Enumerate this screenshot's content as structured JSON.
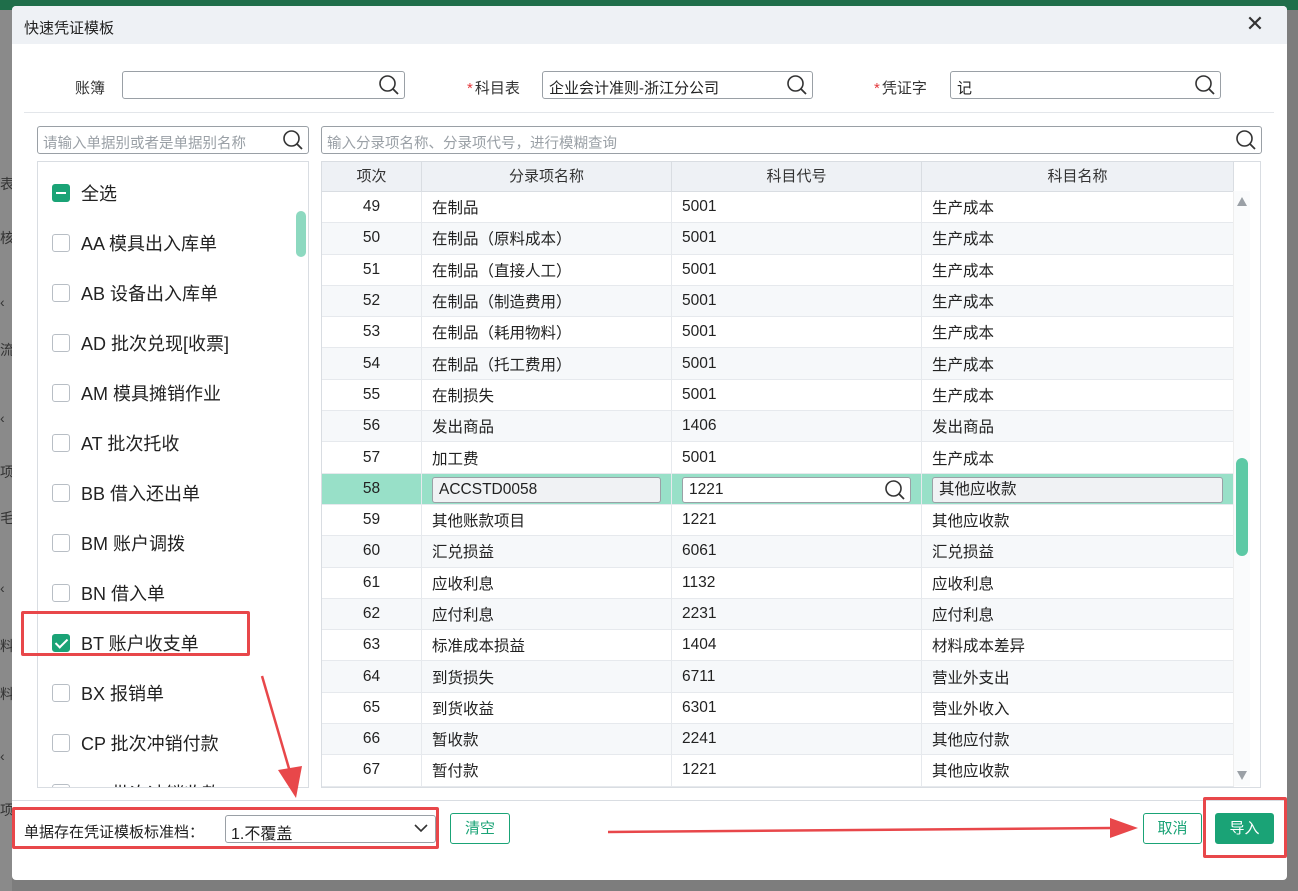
{
  "background": {
    "left_chars": [
      "表",
      "核",
      "‹",
      "流",
      "‹",
      "项",
      "毛",
      "‹",
      "料",
      "料",
      "‹",
      "项"
    ]
  },
  "dialog": {
    "title": "快速凭证模板",
    "close_glyph": "✕"
  },
  "filters": {
    "account_book": {
      "label": "账簿",
      "value": ""
    },
    "subject_table": {
      "label": "科目表",
      "required_mark": "*",
      "value": "企业会计准则-浙江分公司"
    },
    "voucher_type": {
      "label": "凭证字",
      "required_mark": "*",
      "value": "记"
    },
    "bill_search_placeholder": "请输入单据别或者是单据别名称",
    "entry_search_placeholder": "输入分录项名称、分录项代号，进行模糊查询"
  },
  "bill_list": {
    "items": [
      {
        "label": "全选",
        "state": "partial"
      },
      {
        "label": "AA 模具出入库单",
        "state": "unchecked"
      },
      {
        "label": "AB 设备出入库单",
        "state": "unchecked"
      },
      {
        "label": "AD 批次兑现[收票]",
        "state": "unchecked"
      },
      {
        "label": "AM 模具摊销作业",
        "state": "unchecked"
      },
      {
        "label": "AT 批次托收",
        "state": "unchecked"
      },
      {
        "label": "BB 借入还出单",
        "state": "unchecked"
      },
      {
        "label": "BM 账户调拨",
        "state": "unchecked"
      },
      {
        "label": "BN 借入单",
        "state": "unchecked"
      },
      {
        "label": "BT 账户收支单",
        "state": "checked"
      },
      {
        "label": "BX 报销单",
        "state": "unchecked"
      },
      {
        "label": "CP 批次冲销付款",
        "state": "unchecked"
      },
      {
        "label": "CR 批次冲销收款",
        "state": "unchecked"
      }
    ]
  },
  "entry_table": {
    "columns": [
      "项次",
      "分录项名称",
      "科目代号",
      "科目名称"
    ],
    "rows": [
      [
        "49",
        "在制品",
        "5001",
        "生产成本"
      ],
      [
        "50",
        "在制品（原料成本）",
        "5001",
        "生产成本"
      ],
      [
        "51",
        "在制品（直接人工）",
        "5001",
        "生产成本"
      ],
      [
        "52",
        "在制品（制造费用）",
        "5001",
        "生产成本"
      ],
      [
        "53",
        "在制品（耗用物料）",
        "5001",
        "生产成本"
      ],
      [
        "54",
        "在制品（托工费用）",
        "5001",
        "生产成本"
      ],
      [
        "55",
        "在制损失",
        "5001",
        "生产成本"
      ],
      [
        "56",
        "发出商品",
        "1406",
        "发出商品"
      ],
      [
        "57",
        "加工费",
        "5001",
        "生产成本"
      ],
      [
        "58",
        "ACCSTD0058",
        "1221",
        "其他应收款"
      ],
      [
        "59",
        "其他账款项目",
        "1221",
        "其他应收款"
      ],
      [
        "60",
        "汇兑损益",
        "6061",
        "汇兑损益"
      ],
      [
        "61",
        "应收利息",
        "1132",
        "应收利息"
      ],
      [
        "62",
        "应付利息",
        "2231",
        "应付利息"
      ],
      [
        "63",
        "标准成本损益",
        "1404",
        "材料成本差异"
      ],
      [
        "64",
        "到货损失",
        "6711",
        "营业外支出"
      ],
      [
        "65",
        "到货收益",
        "6301",
        "营业外收入"
      ],
      [
        "66",
        "暂收款",
        "2241",
        "其他应付款"
      ],
      [
        "67",
        "暂付款",
        "1221",
        "其他应收款"
      ]
    ],
    "selected_row_index": 9
  },
  "footer": {
    "overwrite_label": "单据存在凭证模板标准档：",
    "overwrite_value": "1.不覆盖",
    "clear_label": "清空",
    "cancel_label": "取消",
    "import_label": "导入"
  },
  "colors": {
    "accent": "#1aa376",
    "selected_row": "#98e0c8",
    "annotation": "#e8474a"
  }
}
